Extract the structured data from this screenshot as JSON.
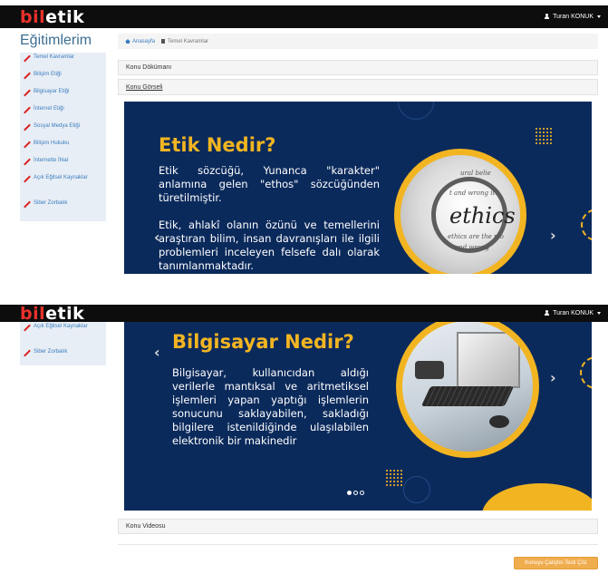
{
  "header": {
    "logo_part1": "bil",
    "logo_part2": "etik",
    "user_name": "Turan KONUK"
  },
  "sidebar": {
    "title": "Eğitimlerim",
    "items": [
      {
        "label": "Temel Kavramlar",
        "icon": "pencil-icon"
      },
      {
        "label": "Bilişim Etiği",
        "icon": "pencil-icon"
      },
      {
        "label": "Bilgisayar Etiği",
        "icon": "pencil-icon"
      },
      {
        "label": "İnternet Etiği",
        "icon": "pencil-icon"
      },
      {
        "label": "Sosyal Medya Etiği",
        "icon": "pencil-icon"
      },
      {
        "label": "Bilişim Hukuku",
        "icon": "pencil-icon"
      },
      {
        "label": "İnternette İhlal",
        "icon": "pencil-icon"
      },
      {
        "label": "Açık Eğitsel Kaynaklar",
        "icon": "pencil-icon"
      },
      {
        "label": "Siber Zorbalık",
        "icon": "pencil-icon"
      }
    ]
  },
  "breadcrumb": {
    "home": "Anasayfa",
    "current": "Temel Kavramlar"
  },
  "panels": {
    "document": "Konu Dökümanı",
    "visual": "Konu Görseli",
    "video": "Konu Videosu"
  },
  "slides": [
    {
      "title": "Etik Nedir?",
      "paragraph1": "Etik sözcüğü, Yunanca \"karakter\" anlamına gelen \"ethos\" sözcüğünden türetilmiştir.",
      "paragraph2": "Etik, ahlakî olanın özünü ve temellerini araştıran bilim, insan davranışları ile ilgili problemleri inceleyen felsefe dalı olarak tanımlanmaktadır.",
      "image_word": "ethics",
      "image_lines": [
        "ural belie",
        "t and wrong it",
        "ethics are the mo",
        "and wrong"
      ]
    },
    {
      "title": "Bilgisayar Nedir?",
      "paragraph1": "Bilgisayar, kullanıcıdan aldığı verilerle mantıksal ve aritmetiksel işlemleri yapan yaptığı işlemlerin sonucunu saklayabilen, sakladığı bilgilere istenildiğinde ulaşılabilen elektronik bir makinedir"
    }
  ],
  "carousel": {
    "slide_count": 3,
    "active_index": 0,
    "prev_symbol": "‹",
    "next_symbol": "›"
  },
  "actions": {
    "quiz_button": "Konuyu Çalıştın Testi Çöz"
  },
  "colors": {
    "header_bg": "#0d0d0d",
    "logo_red": "#e8312b",
    "slide_bg": "#0b2a5c",
    "slide_accent": "#f2b521",
    "quiz_button": "#f0ad4e",
    "link_blue": "#3b7ec0"
  }
}
